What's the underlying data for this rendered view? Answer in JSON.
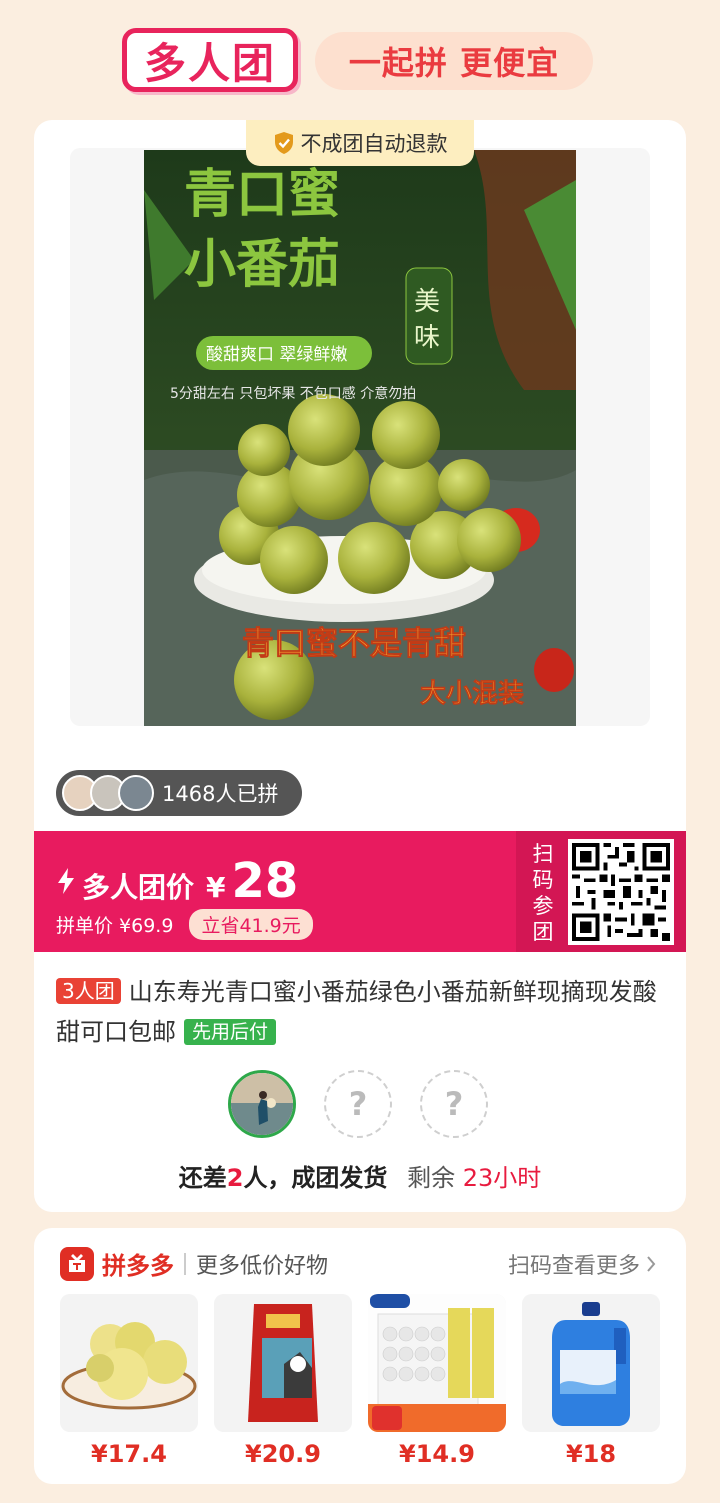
{
  "header": {
    "logo": "多人团",
    "slogan": "一起拼 更便宜"
  },
  "product": {
    "refund_badge": "不成团自动退款",
    "image": {
      "headline_line1": "青口蜜",
      "headline_line2": "小番茄",
      "tag_top": "美",
      "tag_bottom": "味",
      "sub_pill": "酸甜爽口 翠绿鲜嫩",
      "note": "5分甜左右 只包坏果 不包口感 介意勿拍",
      "banner": "青口蜜不是青甜",
      "banner_sub": "大小混装"
    },
    "buyers_count": "1468人已拼",
    "group_price_label": "多人团价",
    "currency": "¥",
    "group_price": "28",
    "single_price_label": "拼单价 ¥69.9",
    "save_label": "立省41.9元",
    "qr_label": "扫码参团",
    "team_tag": "3人团",
    "title": "山东寿光青口蜜小番茄绿色小番茄新鲜现摘现发酸甜可口包邮",
    "pay_tag": "先用后付",
    "members_empty_symbol": "?",
    "status": {
      "prefix": "还差",
      "count": "2",
      "suffix": "人，成团发货",
      "remain_label": "剩余",
      "remain_time": "23小时"
    }
  },
  "more": {
    "brand": "拼多多",
    "subtitle": "更多低价好物",
    "scan_more": "扫码查看更多",
    "items": [
      {
        "price": "¥17.4"
      },
      {
        "price": "¥20.9"
      },
      {
        "price": "¥14.9"
      },
      {
        "price": "¥18"
      }
    ]
  },
  "colors": {
    "brand_red": "#e81b5f",
    "pdd_red": "#e02e24",
    "green": "#37b24d"
  }
}
